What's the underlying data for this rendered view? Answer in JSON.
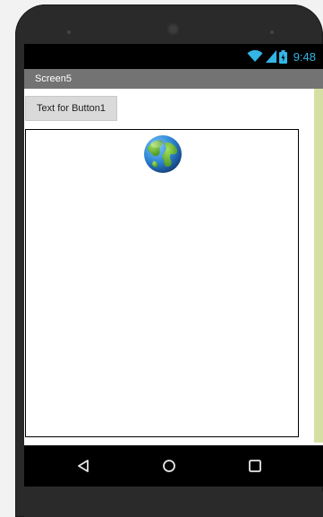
{
  "status_bar": {
    "time": "9:48",
    "icons": [
      "wifi-icon",
      "signal-icon",
      "battery-icon"
    ],
    "accent_color": "#33b5e5"
  },
  "title_bar": {
    "title": "Screen5"
  },
  "main": {
    "button1_label": "Text for Button1",
    "canvas": {
      "sprite_icon": "globe-icon"
    }
  },
  "nav_bar": {
    "buttons": [
      "back-icon",
      "home-icon",
      "recents-icon"
    ]
  },
  "colors": {
    "title_bar": "#737373",
    "scroll_strip": "#d6dfa3",
    "button_bg": "#dadada"
  }
}
